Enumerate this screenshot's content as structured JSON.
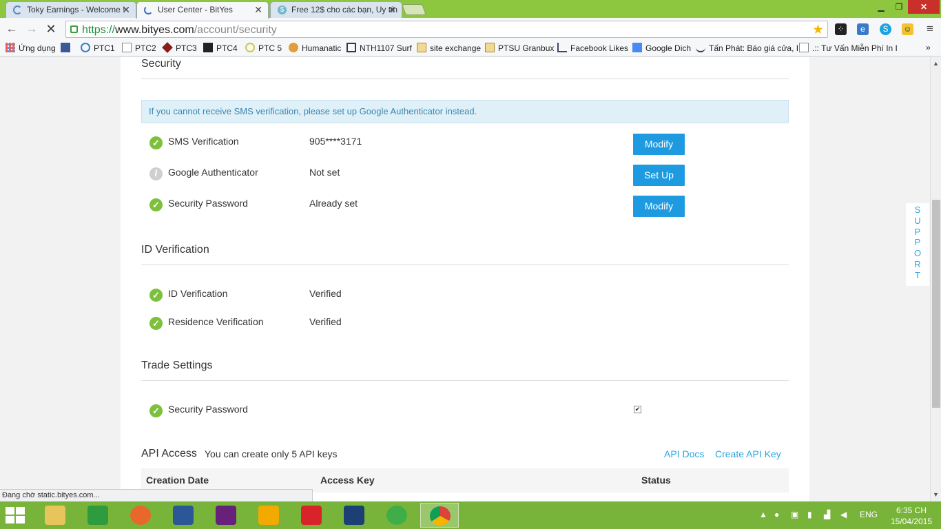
{
  "browser": {
    "tabs": [
      {
        "title": "Toky Earnings - Welcome !",
        "active": false
      },
      {
        "title": "User Center - BitYes",
        "active": true
      },
      {
        "title": "Free 12$ cho các bạn, Uy tín",
        "active": false
      }
    ],
    "url": {
      "scheme": "https://",
      "host": "www.bityes.com",
      "path": "/account/security"
    },
    "bookmarks": [
      "Ứng dụng",
      "PTC1",
      "PTC2",
      "PTC3",
      "PTC4",
      "PTC 5",
      "Humanatic",
      "NTH1107 Surf",
      "site exchange",
      "PTSU Granbux",
      "Facebook Likes",
      "Google Dich",
      "Tấn Phát: Báo giá cửa, I",
      ".:: Tư Vấn Miễn Phí In I"
    ],
    "status_text": "Đang chờ static.bityes.com..."
  },
  "security": {
    "title": "Security",
    "alert": "If you cannot receive SMS verification, please set up Google Authenticator instead.",
    "rows": [
      {
        "label": "SMS Verification",
        "value": "905****3171",
        "button": "Modify",
        "state": "ok"
      },
      {
        "label": "Google Authenticator",
        "value": "Not set",
        "button": "Set Up",
        "state": "info"
      },
      {
        "label": "Security Password",
        "value": "Already set",
        "button": "Modify",
        "state": "ok"
      }
    ]
  },
  "id_verification": {
    "title": "ID Verification",
    "rows": [
      {
        "label": "ID Verification",
        "value": "Verified"
      },
      {
        "label": "Residence Verification",
        "value": "Verified"
      }
    ]
  },
  "trade_settings": {
    "title": "Trade Settings",
    "rows": [
      {
        "label": "Security Password",
        "checked": true
      }
    ]
  },
  "api_access": {
    "title": "API Access",
    "subtitle": "You can create only 5 API keys",
    "links": [
      "API Docs",
      "Create API Key"
    ],
    "columns": [
      "Creation Date",
      "Access Key",
      "Status"
    ]
  },
  "support_label": [
    "S",
    "U",
    "P",
    "P",
    "O",
    "R",
    "T"
  ],
  "taskbar": {
    "lang": "ENG",
    "time": "6:35 CH",
    "date": "15/04/2015"
  },
  "colors": {
    "accent": "#1e9be0",
    "link": "#2ba6de",
    "success": "#7cc03c",
    "alert_bg": "#dff0f8",
    "tabstrip": "#8dc63f",
    "taskbar": "#79b43a"
  }
}
